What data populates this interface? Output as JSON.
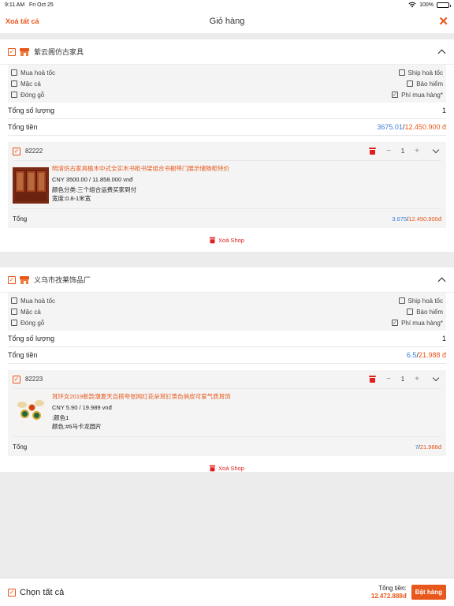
{
  "status_bar": {
    "time": "9:11 AM",
    "date": "Fri Oct 25",
    "battery": "100%"
  },
  "header": {
    "left_action": "Xoá tất cả",
    "title": "Giỏ hàng",
    "close_symbol": "✕"
  },
  "options_labels": {
    "fast_buy": "Mua hoả tốc",
    "fast_ship": "Ship hoả tốc",
    "bargain": "Mặc cả",
    "insurance": "Bảo hiểm",
    "wood_pack": "Đóng gỗ",
    "buy_fee": "Phí mua hàng*"
  },
  "summary_labels": {
    "total_qty": "Tổng số lượng",
    "total_money": "Tổng tiền",
    "item_total": "Tổng"
  },
  "shops": [
    {
      "name": "紫云阁仿古家具",
      "total_qty": "1",
      "total_cny": "3675.01",
      "total_vnd": "12.450.900 đ",
      "item": {
        "id": "82222",
        "qty": "1",
        "name": "明清仿古家具榆木中式全实木书柜书架组合书橱带门展示储物柜特价",
        "price": "CNY 3500.00 / 11.858.000 vnđ",
        "attr1": "颜色分类:三个组合运费买家到付",
        "attr2": "宽度:0.8-1米宽",
        "total_cny": "3.675",
        "total_vnd": "12.450.900đ"
      },
      "delete_label": "Xoá Shop"
    },
    {
      "name": "义乌市孜莱饰品厂",
      "total_qty": "1",
      "total_cny": "6.5",
      "total_vnd": "21.988 đ",
      "item": {
        "id": "82223",
        "qty": "1",
        "name": "耳环女2019新款潮夏天百搭夸张网红花朵耳钉黄色俏皮可爱气质耳饰",
        "price": "CNY 5.90 / 19.989 vnđ",
        "attr1": ":颜色1",
        "attr2": "颜色:#6马卡龙圆片",
        "total_cny": "7",
        "total_vnd": "21.988đ"
      },
      "delete_label": "Xoá Shop"
    }
  ],
  "footer": {
    "select_all": "Chọn tất cả",
    "total_label": "Tổng tiền:",
    "total_amount": "12.472.888đ",
    "order_button": "Đặt hàng"
  },
  "colors": {
    "accent": "#e8571b",
    "blue": "#3b7ddd",
    "delete_red": "#e02020"
  }
}
